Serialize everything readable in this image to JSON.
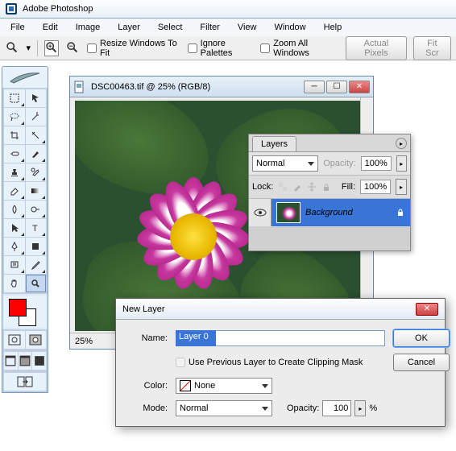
{
  "app": {
    "title": "Adobe Photoshop"
  },
  "menu": [
    "File",
    "Edit",
    "Image",
    "Layer",
    "Select",
    "Filter",
    "View",
    "Window",
    "Help"
  ],
  "opt": {
    "resize": "Resize Windows To Fit",
    "ignore": "Ignore Palettes",
    "zoomall": "Zoom All Windows",
    "actual": "Actual Pixels",
    "fitscr": "Fit Scr"
  },
  "doc": {
    "title": "DSC00463.tif @ 25% (RGB/8)",
    "zoom": "25%"
  },
  "layers": {
    "tab": "Layers",
    "blend": "Normal",
    "opacity_lbl": "Opacity:",
    "opacity": "100%",
    "lock_lbl": "Lock:",
    "fill_lbl": "Fill:",
    "fill": "100%",
    "row0": "Background"
  },
  "dlg": {
    "title": "New Layer",
    "name_lbl": "Name:",
    "name_val": "Layer 0",
    "clip": "Use Previous Layer to Create Clipping Mask",
    "color_lbl": "Color:",
    "color_val": "None",
    "mode_lbl": "Mode:",
    "mode_val": "Normal",
    "op_lbl": "Opacity:",
    "op_val": "100",
    "pct": "%",
    "ok": "OK",
    "cancel": "Cancel"
  }
}
